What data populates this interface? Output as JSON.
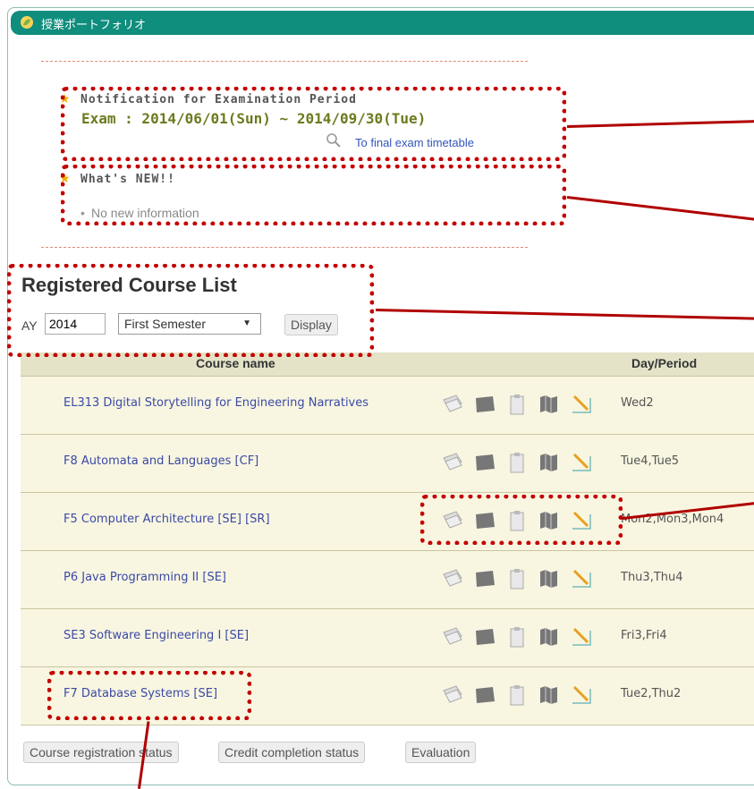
{
  "header": {
    "title": "授業ポートフォリオ"
  },
  "notice": {
    "title": "Notification for Examination Period",
    "exam_text": "Exam : 2014/06/01(Sun) ~ 2014/09/30(Tue)",
    "link_prefix": "To ",
    "link_text": "final exam timetable"
  },
  "news": {
    "title": "What's NEW!!",
    "items": [
      "No new information"
    ]
  },
  "course_list": {
    "title": "Registered Course List",
    "ay_label": "AY",
    "ay_value": "2014",
    "semester": "First Semester",
    "display_button": "Display",
    "col_course": "Course name",
    "col_day": "Day/Period",
    "rows": [
      {
        "name": "EL313 Digital Storytelling for Engineering Narratives",
        "day": "Wed2"
      },
      {
        "name": "F8 Automata and Languages [CF]",
        "day": "Tue4,Tue5"
      },
      {
        "name": "F5 Computer Architecture [SE] [SR]",
        "day": "Mon2,Mon3,Mon4"
      },
      {
        "name": "P6 Java Programming II [SE]",
        "day": "Thu3,Thu4"
      },
      {
        "name": "SE3 Software Engineering I [SE]",
        "day": "Fri3,Fri4"
      },
      {
        "name": "F7 Database Systems [SE]",
        "day": "Tue2,Thu2"
      }
    ]
  },
  "footer": {
    "btn_registration": "Course registration status",
    "btn_credit": "Credit completion status",
    "btn_evaluation": "Evaluation"
  },
  "colors": {
    "header": "#0f8d7d",
    "link": "#3b49a6",
    "annotation": "#c40000",
    "row_bg": "#f8f6e1"
  }
}
